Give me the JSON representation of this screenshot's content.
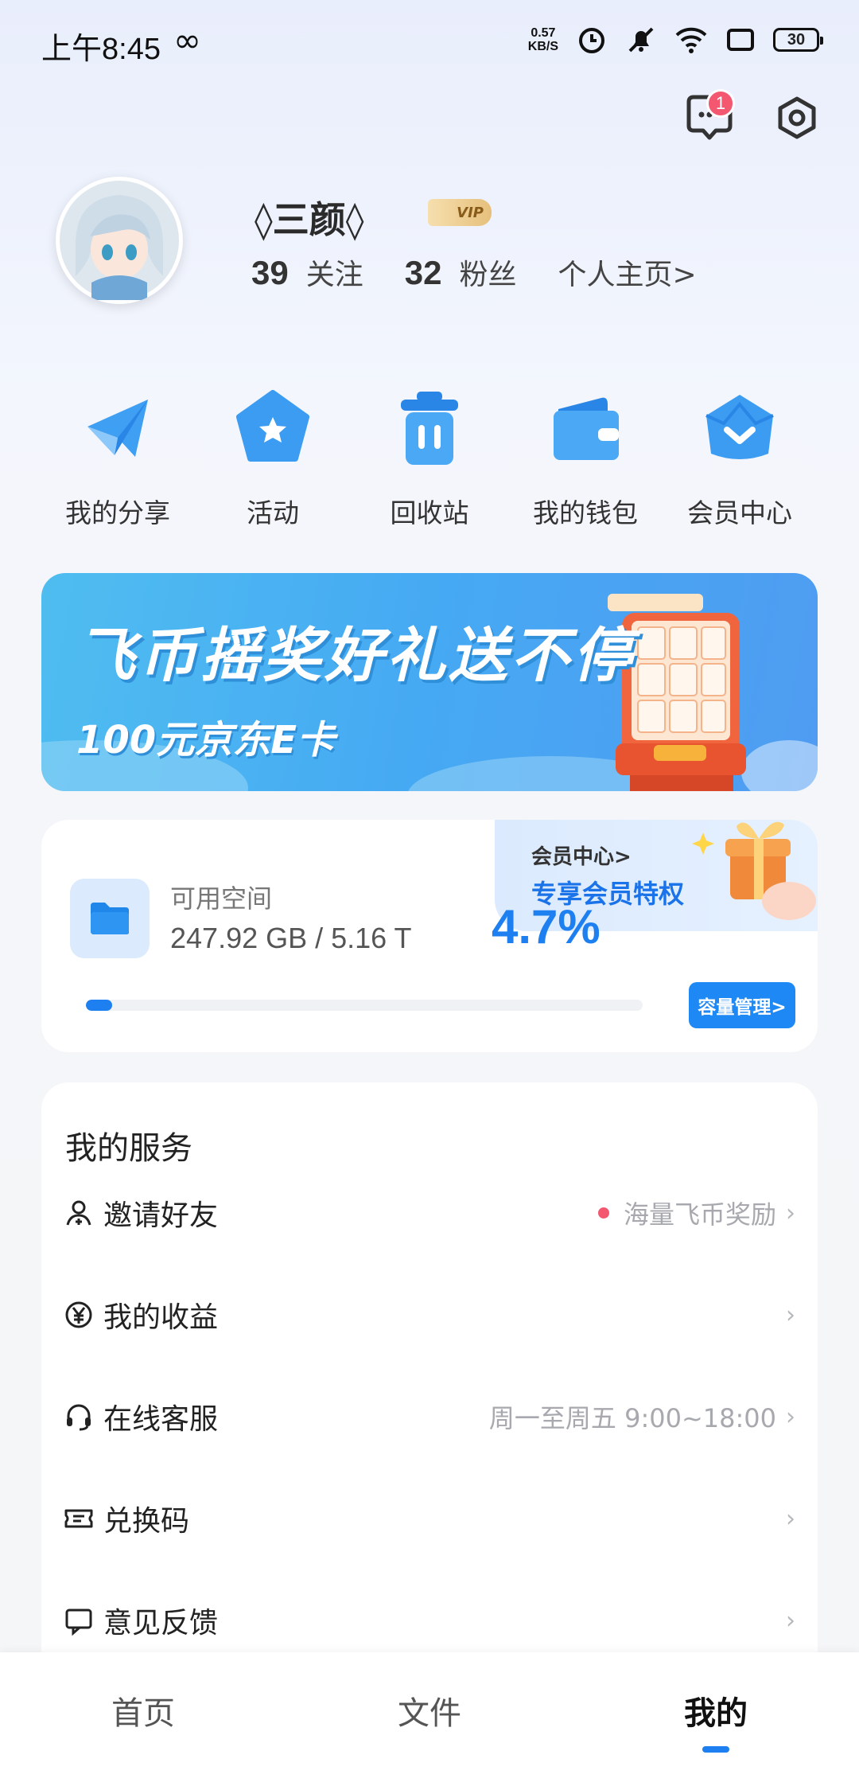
{
  "status_bar": {
    "time": "上午8:45",
    "infinity": "∞",
    "net_speed_value": "0.57",
    "net_speed_unit": "KB/S",
    "battery": "30"
  },
  "header": {
    "message_badge": "1"
  },
  "profile": {
    "username": "◊三颜◊",
    "vip_label": "VIP",
    "following_count": "39",
    "following_label": "关注",
    "fans_count": "32",
    "fans_label": "粉丝",
    "homepage_link": "个人主页>"
  },
  "quick_actions": [
    {
      "label": "我的分享",
      "icon": "paper-plane-icon"
    },
    {
      "label": "活动",
      "icon": "star-badge-icon"
    },
    {
      "label": "回收站",
      "icon": "trash-icon"
    },
    {
      "label": "我的钱包",
      "icon": "wallet-icon"
    },
    {
      "label": "会员中心",
      "icon": "crown-icon"
    }
  ],
  "banner": {
    "title": "飞币摇奖好礼送不停",
    "subtitle": "100元京东E卡"
  },
  "storage": {
    "vip_center_link": "会员中心>",
    "vip_privilege": "专享会员特权",
    "space_label": "可用空间",
    "space_value": "247.92 GB / 5.16 T",
    "percent_text": "4.7%",
    "usage_fraction": 0.047,
    "manage_button": "容量管理>"
  },
  "services": {
    "title": "我的服务",
    "items": [
      {
        "label": "邀请好友",
        "right_text": "海量飞币奖励",
        "has_dot": true,
        "icon": "invite-user-icon"
      },
      {
        "label": "我的收益",
        "right_text": "",
        "has_dot": false,
        "icon": "yuan-coin-icon"
      },
      {
        "label": "在线客服",
        "right_text": "周一至周五 9:00~18:00",
        "has_dot": false,
        "icon": "headset-icon"
      },
      {
        "label": "兑换码",
        "right_text": "",
        "has_dot": false,
        "icon": "ticket-icon"
      },
      {
        "label": "意见反馈",
        "right_text": "",
        "has_dot": false,
        "icon": "feedback-icon"
      }
    ]
  },
  "bottom_nav": {
    "items": [
      "首页",
      "文件",
      "我的"
    ],
    "active_index": 2
  },
  "colors": {
    "accent": "#1e7ff0",
    "badge": "#f45870"
  }
}
